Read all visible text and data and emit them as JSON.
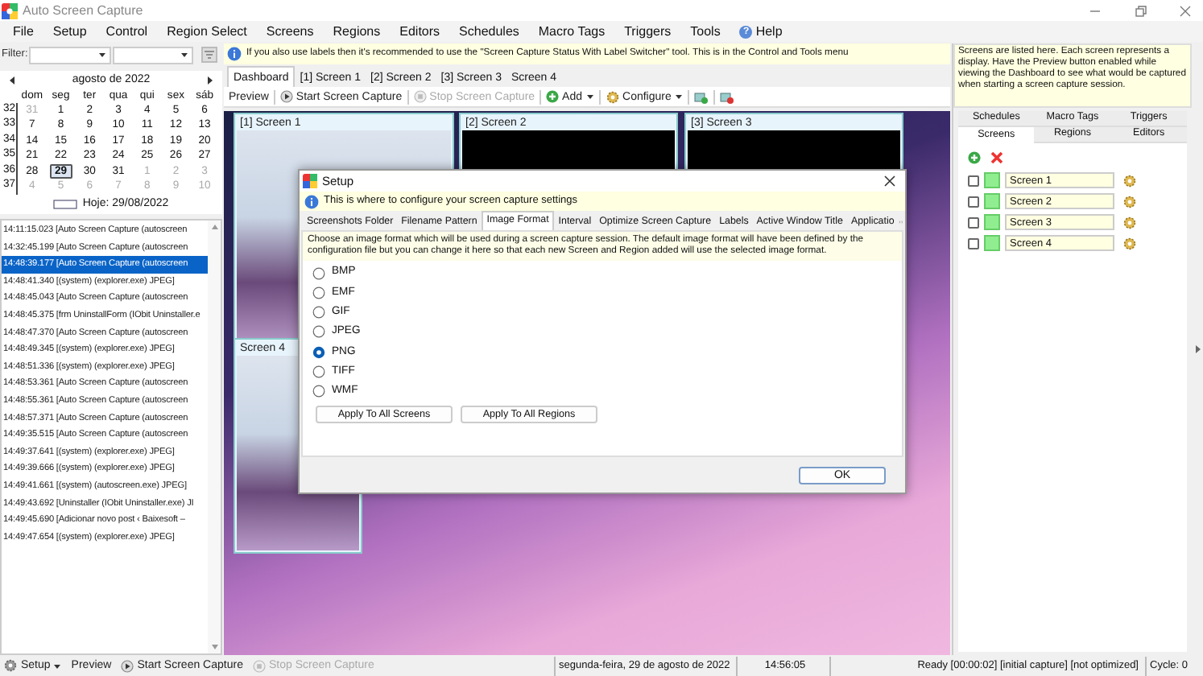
{
  "window": {
    "title": "Auto Screen Capture"
  },
  "help_icon": "?",
  "menu": [
    "File",
    "Setup",
    "Control",
    "Region Select",
    "Screens",
    "Regions",
    "Editors",
    "Schedules",
    "Macro Tags",
    "Triggers",
    "Tools",
    "Help"
  ],
  "filter": {
    "label": "Filter:"
  },
  "calendar": {
    "month": "agosto de 2022",
    "weekdays": [
      "dom",
      "seg",
      "ter",
      "qua",
      "qui",
      "sex",
      "sáb"
    ],
    "weeks": [
      {
        "number": "32",
        "days": [
          {
            "day": "31",
            "muted": true,
            "selected": false
          },
          {
            "day": "1",
            "muted": false,
            "selected": false
          },
          {
            "day": "2",
            "muted": false,
            "selected": false
          },
          {
            "day": "3",
            "muted": false,
            "selected": false
          },
          {
            "day": "4",
            "muted": false,
            "selected": false
          },
          {
            "day": "5",
            "muted": false,
            "selected": false
          },
          {
            "day": "6",
            "muted": false,
            "selected": false
          }
        ]
      },
      {
        "number": "33",
        "days": [
          {
            "day": "7",
            "muted": false,
            "selected": false
          },
          {
            "day": "8",
            "muted": false,
            "selected": false
          },
          {
            "day": "9",
            "muted": false,
            "selected": false
          },
          {
            "day": "10",
            "muted": false,
            "selected": false
          },
          {
            "day": "11",
            "muted": false,
            "selected": false
          },
          {
            "day": "12",
            "muted": false,
            "selected": false
          },
          {
            "day": "13",
            "muted": false,
            "selected": false
          }
        ]
      },
      {
        "number": "34",
        "days": [
          {
            "day": "14",
            "muted": false,
            "selected": false
          },
          {
            "day": "15",
            "muted": false,
            "selected": false
          },
          {
            "day": "16",
            "muted": false,
            "selected": false
          },
          {
            "day": "17",
            "muted": false,
            "selected": false
          },
          {
            "day": "18",
            "muted": false,
            "selected": false
          },
          {
            "day": "19",
            "muted": false,
            "selected": false
          },
          {
            "day": "20",
            "muted": false,
            "selected": false
          }
        ]
      },
      {
        "number": "35",
        "days": [
          {
            "day": "21",
            "muted": false,
            "selected": false
          },
          {
            "day": "22",
            "muted": false,
            "selected": false
          },
          {
            "day": "23",
            "muted": false,
            "selected": false
          },
          {
            "day": "24",
            "muted": false,
            "selected": false
          },
          {
            "day": "25",
            "muted": false,
            "selected": false
          },
          {
            "day": "26",
            "muted": false,
            "selected": false
          },
          {
            "day": "27",
            "muted": false,
            "selected": false
          }
        ]
      },
      {
        "number": "36",
        "days": [
          {
            "day": "28",
            "muted": false,
            "selected": false
          },
          {
            "day": "29",
            "muted": false,
            "selected": true
          },
          {
            "day": "30",
            "muted": false,
            "selected": false
          },
          {
            "day": "31",
            "muted": false,
            "selected": false
          },
          {
            "day": "1",
            "muted": true,
            "selected": false
          },
          {
            "day": "2",
            "muted": true,
            "selected": false
          },
          {
            "day": "3",
            "muted": true,
            "selected": false
          }
        ]
      },
      {
        "number": "37",
        "days": [
          {
            "day": "4",
            "muted": true,
            "selected": false
          },
          {
            "day": "5",
            "muted": true,
            "selected": false
          },
          {
            "day": "6",
            "muted": true,
            "selected": false
          },
          {
            "day": "7",
            "muted": true,
            "selected": false
          },
          {
            "day": "8",
            "muted": true,
            "selected": false
          },
          {
            "day": "9",
            "muted": true,
            "selected": false
          },
          {
            "day": "10",
            "muted": true,
            "selected": false
          }
        ]
      }
    ],
    "today": "Hoje: 29/08/2022"
  },
  "log": [
    {
      "text": "14:11:15.023 [Auto Screen Capture (autoscreen",
      "selected": false
    },
    {
      "text": "14:32:45.199 [Auto Screen Capture (autoscreen",
      "selected": false
    },
    {
      "text": "14:48:39.177 [Auto Screen Capture (autoscreen",
      "selected": true
    },
    {
      "text": "14:48:41.340 [(system) (explorer.exe) JPEG]",
      "selected": false
    },
    {
      "text": "14:48:45.043 [Auto Screen Capture (autoscreen",
      "selected": false
    },
    {
      "text": "14:48:45.375 [frm UninstallForm (IObit Uninstaller.e",
      "selected": false
    },
    {
      "text": "14:48:47.370 [Auto Screen Capture (autoscreen",
      "selected": false
    },
    {
      "text": "14:48:49.345 [(system) (explorer.exe) JPEG]",
      "selected": false
    },
    {
      "text": "14:48:51.336 [(system) (explorer.exe) JPEG]",
      "selected": false
    },
    {
      "text": "14:48:53.361 [Auto Screen Capture (autoscreen",
      "selected": false
    },
    {
      "text": "14:48:55.361 [Auto Screen Capture (autoscreen",
      "selected": false
    },
    {
      "text": "14:48:57.371 [Auto Screen Capture (autoscreen",
      "selected": false
    },
    {
      "text": "14:49:35.515 [Auto Screen Capture (autoscreen",
      "selected": false
    },
    {
      "text": "14:49:37.641 [(system) (explorer.exe) JPEG]",
      "selected": false
    },
    {
      "text": "14:49:39.666 [(system) (explorer.exe) JPEG]",
      "selected": false
    },
    {
      "text": "14:49:41.661 [(system) (autoscreen.exe) JPEG]",
      "selected": false
    },
    {
      "text": "14:49:43.692 [Uninstaller (IObit Uninstaller.exe) JI",
      "selected": false
    },
    {
      "text": "14:49:45.690 [Adicionar novo post ‹ Baixesoft –",
      "selected": false
    },
    {
      "text": "14:49:47.654 [(system) (explorer.exe) JPEG]",
      "selected": false
    }
  ],
  "info": "If you also use labels then it's recommended to use the \"Screen Capture Status With Label Switcher\" tool. This is in the Control and Tools menu",
  "tabs": [
    {
      "label": "Dashboard",
      "selected": true
    },
    {
      "label": "[1] Screen 1",
      "selected": false
    },
    {
      "label": "[2] Screen 2",
      "selected": false
    },
    {
      "label": "[3] Screen 3",
      "selected": false
    },
    {
      "label": "Screen 4",
      "selected": false
    }
  ],
  "toolbar": [
    {
      "kind": "text",
      "label": "Preview",
      "disabled": false
    },
    {
      "kind": "start",
      "label": "Start Screen Capture",
      "disabled": false
    },
    {
      "kind": "stop",
      "label": "Stop Screen Capture",
      "disabled": true
    },
    {
      "kind": "add",
      "label": "Add",
      "disabled": false
    },
    {
      "kind": "configure",
      "label": "Configure",
      "disabled": false
    },
    {
      "kind": "icon"
    },
    {
      "kind": "icon2"
    }
  ],
  "previews": [
    {
      "title": "[1] Screen 1",
      "kind": "screenshot"
    },
    {
      "title": "[2] Screen 2",
      "kind": "black"
    },
    {
      "title": "[3] Screen 3",
      "kind": "black"
    },
    {
      "title": "Screen 4",
      "kind": "screenshot"
    }
  ],
  "setup": {
    "title": "Setup",
    "info": "This is where to configure your screen capture settings",
    "tabs": [
      {
        "label": "Screenshots Folder",
        "selected": false
      },
      {
        "label": "Filename Pattern",
        "selected": false
      },
      {
        "label": "Image Format",
        "selected": true
      },
      {
        "label": "Interval",
        "selected": false
      },
      {
        "label": "Optimize Screen Capture",
        "selected": false
      },
      {
        "label": "Labels",
        "selected": false
      },
      {
        "label": "Active Window Title",
        "selected": false
      },
      {
        "label": "Applicatio",
        "selected": false
      }
    ],
    "description": "Choose an image format which will be used during a screen capture session. The default image format will have been defined by the configuration file but you can change it here so that each new Screen and Region added will use the selected image format.",
    "formats": [
      {
        "label": "BMP",
        "selected": false
      },
      {
        "label": "EMF",
        "selected": false
      },
      {
        "label": "GIF",
        "selected": false
      },
      {
        "label": "JPEG",
        "selected": false
      },
      {
        "label": "PNG",
        "selected": true
      },
      {
        "label": "TIFF",
        "selected": false
      },
      {
        "label": "WMF",
        "selected": false
      }
    ],
    "buttons": [
      "Apply To All Screens",
      "Apply To All Regions"
    ],
    "ok": "OK"
  },
  "right_panel": {
    "info": "Screens are listed here. Each screen represents a display. Have the Preview button enabled while viewing the Dashboard to see what would be captured when starting a screen capture session.",
    "tab_rows": [
      [
        {
          "label": "Schedules",
          "selected": false
        },
        {
          "label": "Macro Tags",
          "selected": false
        },
        {
          "label": "Triggers",
          "selected": false
        }
      ],
      [
        {
          "label": "Screens",
          "selected": true
        },
        {
          "label": "Regions",
          "selected": false
        },
        {
          "label": "Editors",
          "selected": false
        }
      ]
    ],
    "screens": [
      {
        "name": "Screen 1",
        "checked": false
      },
      {
        "name": "Screen 2",
        "checked": false
      },
      {
        "name": "Screen 3",
        "checked": false
      },
      {
        "name": "Screen 4",
        "checked": false
      }
    ]
  },
  "status_bar": {
    "buttons": [
      {
        "kind": "setup",
        "label": "Setup",
        "disabled": false
      },
      {
        "kind": "text",
        "label": "Preview",
        "disabled": false
      },
      {
        "kind": "start",
        "label": "Start Screen Capture",
        "disabled": false
      },
      {
        "kind": "stop",
        "label": "Stop Screen Capture",
        "disabled": true
      }
    ],
    "date": "segunda-feira, 29 de agosto de 2022",
    "time": "14:56:05",
    "status": "Ready [00:00:02] [initial capture] [not optimized]",
    "cycle": "Cycle: 0"
  }
}
